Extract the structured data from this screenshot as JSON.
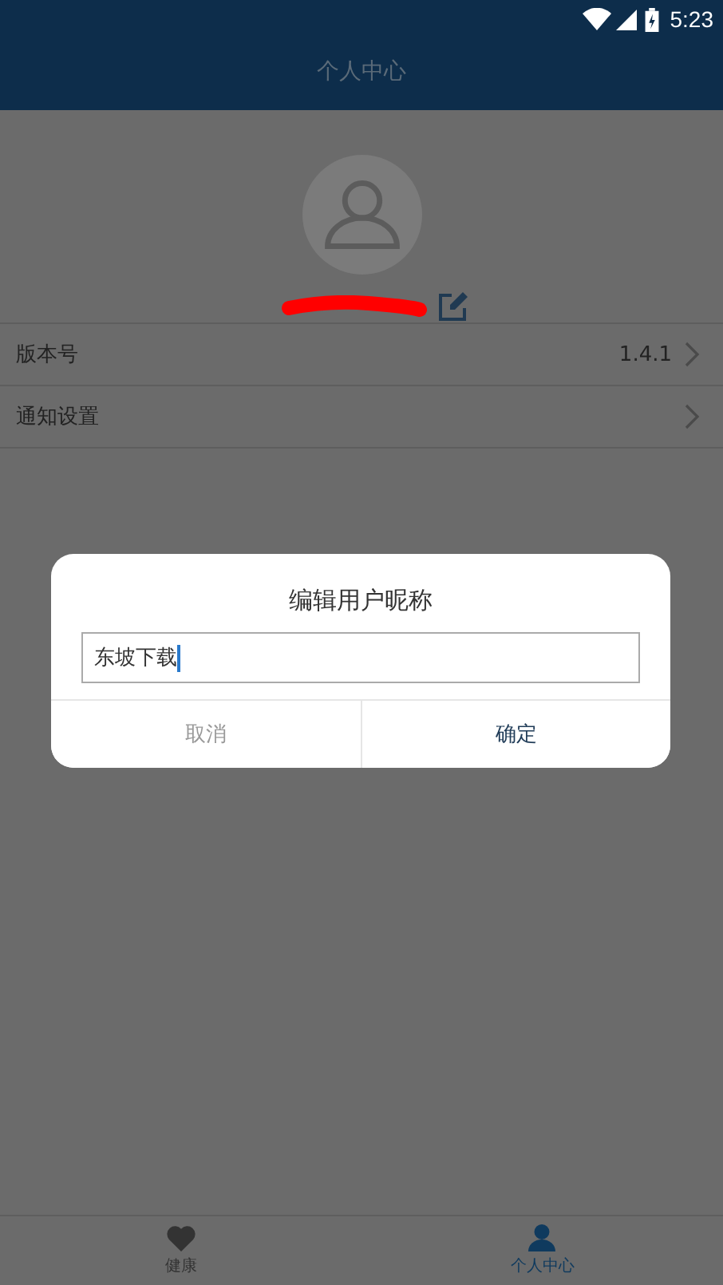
{
  "status_bar": {
    "time": "5:23"
  },
  "header": {
    "title": "个人中心"
  },
  "settings": [
    {
      "label": "版本号",
      "value": "1.4.1"
    },
    {
      "label": "通知设置"
    }
  ],
  "dialog": {
    "title": "编辑用户昵称",
    "input": {
      "value": "东坡下载"
    },
    "buttons": [
      {
        "label": "取消",
        "kind": "cancel"
      },
      {
        "label": "确定",
        "kind": "confirm"
      }
    ]
  },
  "bottom_nav": [
    {
      "label": "健康",
      "kind": "heart",
      "selected": false
    },
    {
      "label": "个人中心",
      "kind": "person",
      "selected": true
    }
  ]
}
